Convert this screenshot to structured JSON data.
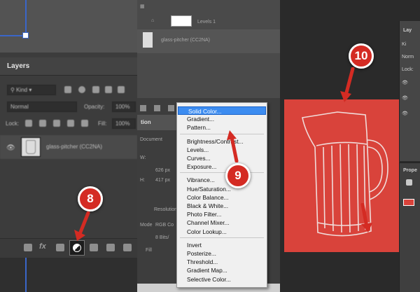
{
  "panel1": {
    "layers_title": "Layers",
    "kind_label": "Kind",
    "blend_mode": "Normal",
    "opacity_label": "Opacity:",
    "opacity_value": "100%",
    "lock_label": "Lock:",
    "fill_label": "Fill:",
    "fill_value": "100%",
    "layer_name": "glass-pitcher (CC2NA)",
    "fx_label": "fx",
    "callout": "8"
  },
  "panel2": {
    "levels_layer": "Levels 1",
    "pitcher_layer": "glass-pitcher (CC2NA)",
    "props_tab": "tion",
    "document_label": "Document",
    "w_label": "W:",
    "w_value": "626 px",
    "h_label": "H:",
    "h_value": "417 px",
    "resolution_label": "Resolution",
    "mode_label": "Mode",
    "mode_value": "RGB Co",
    "bits_value": "8 Bits/",
    "fill_label": "Fill",
    "callout": "9"
  },
  "menu": {
    "groups": [
      [
        "Solid Color...",
        "Gradient...",
        "Pattern..."
      ],
      [
        "Brightness/Contrast...",
        "Levels...",
        "Curves...",
        "Exposure..."
      ],
      [
        "Vibrance...",
        "Hue/Saturation...",
        "Color Balance...",
        "Black & White...",
        "Photo Filter...",
        "Channel Mixer...",
        "Color Lookup..."
      ],
      [
        "Invert",
        "Posterize...",
        "Threshold...",
        "Gradient Map...",
        "Selective Color..."
      ]
    ],
    "selected": "Solid Color..."
  },
  "panel3": {
    "layers_label": "Lay",
    "kind_label": "Ki",
    "blend_label": "Norm",
    "lock_label": "Lock:",
    "props_label": "Prope",
    "callout": "10",
    "fill_color": "#d9433b"
  },
  "colors": {
    "callout_red": "#d42b23",
    "menu_highlight": "#3c8cf0",
    "canvas_red": "#d9433b"
  }
}
